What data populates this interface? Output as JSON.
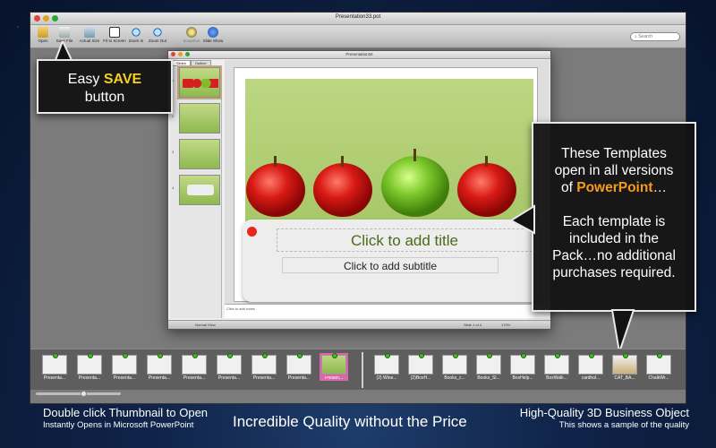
{
  "window": {
    "title": "Presentation33.pot"
  },
  "toolbar": {
    "buttons": [
      {
        "label": "Open"
      },
      {
        "label": "Save File"
      },
      {
        "label": "Actual Size"
      },
      {
        "label": "Fit to Screen"
      },
      {
        "label": "Zoom In"
      },
      {
        "label": "Zoom Out"
      },
      {
        "label": "Snapshot"
      },
      {
        "label": "Slide Show"
      }
    ],
    "search_placeholder": "Search"
  },
  "doc": {
    "title": "Presentation34",
    "tabs": [
      "Slides",
      "Outline"
    ],
    "slide": {
      "title_placeholder": "Click to add title",
      "subtitle_placeholder": "Click to add subtitle"
    },
    "notes": "Click to add notes",
    "status_view": "Normal View",
    "status_slide": "Slide 1 of 4",
    "status_zoom": "170%"
  },
  "callouts": {
    "save": {
      "pre": "Easy ",
      "highlight": "SAVE",
      "post": "button"
    },
    "templates": {
      "line1": "These Templates",
      "line2": "open in all versions",
      "line3_pre": "of ",
      "line3_highlight": "PowerPoint",
      "line3_post": "…",
      "line4": "Each template is",
      "line5": "included in the",
      "line6": "Pack…no additional",
      "line7": "purchases required."
    }
  },
  "templates_left": [
    "Presenta...",
    "Presenta...",
    "Presenta...",
    "Presenta...",
    "Presenta...",
    "Presenta...",
    "Presenta...",
    "Presenta...",
    "Presen..."
  ],
  "templates_right": [
    "(2) Wine...",
    "(2)BoxH...",
    "Books_c...",
    "Books_Sl...",
    "BoxHelp...",
    "BoxWalk...",
    "cardhol...",
    "CAT_BA...",
    "ChalkWr..."
  ],
  "captions": {
    "left_line1": "Double click Thumbnail to Open",
    "left_line2": "Instantly Opens in Microsoft PowerPoint",
    "center": "Incredible Quality without the Price",
    "right_line1": "High-Quality 3D Business Object",
    "right_line2": "This shows a sample of the quality"
  },
  "colors": {
    "accent_save": "#f5d020",
    "accent_powerpoint": "#f59b1e",
    "selection": "#e25eb0"
  }
}
